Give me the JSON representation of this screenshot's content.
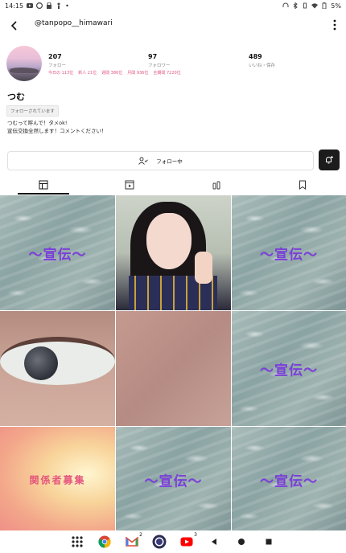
{
  "status_bar": {
    "time": "14:15",
    "battery": "5%"
  },
  "profile": {
    "handle": "@tanpopo__himawari",
    "display_name": "つむ",
    "follows_you_badge": "フォローされています",
    "bio_line1": "つむって呼んで！タメok!",
    "bio_line2": "宣伝交換全然します！コメントください！",
    "stats": [
      {
        "value": "207",
        "label": "フォロー"
      },
      {
        "value": "97",
        "label": "フォロワー"
      },
      {
        "value": "489",
        "label": "いいね・保存"
      }
    ],
    "ranks": [
      "今日の 113位",
      "新人 21位",
      "週間 386位",
      "月間 936位",
      "全期間 7220位"
    ]
  },
  "actions": {
    "follow_label": "フォロー中"
  },
  "tabs": [
    {
      "name": "posts-grid",
      "icon": "grid-icon",
      "active": true
    },
    {
      "name": "videos",
      "icon": "play-icon",
      "active": false
    },
    {
      "name": "likes",
      "icon": "bottles-icon",
      "active": false
    },
    {
      "name": "saved",
      "icon": "bookmark-icon",
      "active": false
    }
  ],
  "grid": [
    {
      "kind": "water",
      "text": "〜宣伝〜"
    },
    {
      "kind": "selfie",
      "text": ""
    },
    {
      "kind": "water",
      "text": "〜宣伝〜"
    },
    {
      "kind": "eye",
      "text": ""
    },
    {
      "kind": "skin",
      "text": ""
    },
    {
      "kind": "water",
      "text": "〜宣伝〜"
    },
    {
      "kind": "warm",
      "text": "関係者募集"
    },
    {
      "kind": "water",
      "text": "〜宣伝〜"
    },
    {
      "kind": "water",
      "text": "〜宣伝〜"
    }
  ],
  "nav": {
    "gmail_badge": "2",
    "youtube_badge": "3"
  },
  "colors": {
    "accent_pink": "#e0577f",
    "promo_purple": "#7b3fd8"
  }
}
